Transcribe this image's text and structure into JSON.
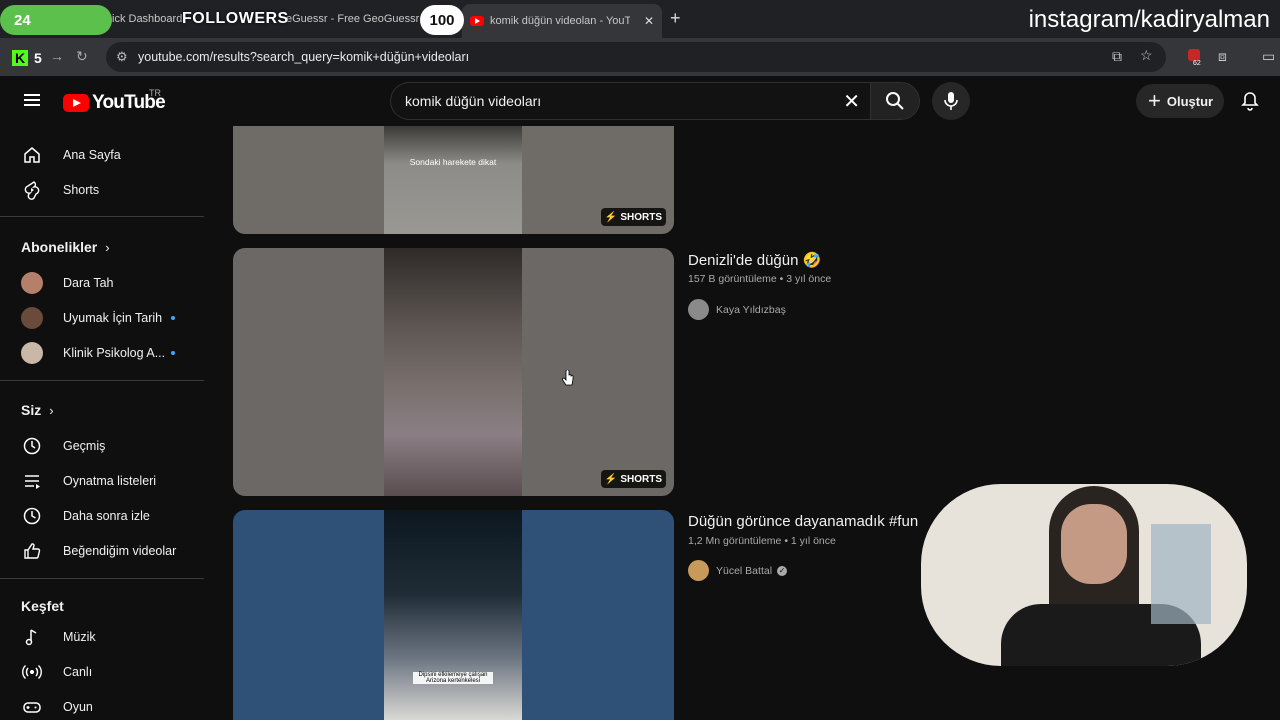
{
  "overlay": {
    "left_badge_number": "24",
    "followers_label": "FOLLOWERS",
    "followers_count": "100",
    "instagram_handle": "instagram/kadiryalman",
    "kick_count": "5"
  },
  "browser": {
    "tabs": [
      {
        "label": "ick Dashboard"
      },
      {
        "label": "eGuessr - Free GeoGuessr A"
      },
      {
        "label": "komik düğün videolan - YouTu",
        "active": true
      }
    ],
    "url": "youtube.com/results?search_query=komik+düğün+videoları",
    "extension_badge": "62"
  },
  "header": {
    "logo_text": "YouTube",
    "country_code": "TR",
    "search_value": "komik düğün videoları",
    "create_label": "Oluştur"
  },
  "sidebar": {
    "main": [
      {
        "label": "Ana Sayfa",
        "icon": "home-icon"
      },
      {
        "label": "Shorts",
        "icon": "shorts-icon"
      }
    ],
    "subscriptions_heading": "Abonelikler",
    "subscriptions": [
      {
        "label": "Dara Tah",
        "new": false
      },
      {
        "label": "Uyumak İçin Tarih",
        "new": true
      },
      {
        "label": "Klinik Psikolog A...",
        "new": true
      }
    ],
    "you_heading": "Siz",
    "you": [
      {
        "label": "Geçmiş",
        "icon": "history-icon"
      },
      {
        "label": "Oynatma listeleri",
        "icon": "playlists-icon"
      },
      {
        "label": "Daha sonra izle",
        "icon": "watch-later-icon"
      },
      {
        "label": "Beğendiğim videolar",
        "icon": "like-icon"
      }
    ],
    "explore_heading": "Keşfet",
    "explore": [
      {
        "label": "Müzik",
        "icon": "music-icon"
      },
      {
        "label": "Canlı",
        "icon": "live-icon"
      },
      {
        "label": "Oyun",
        "icon": "gaming-icon"
      }
    ]
  },
  "results": [
    {
      "badge": "SHORTS",
      "overlay_caption": "Sondaki harekete dikat"
    },
    {
      "title": "Denizli'de düğün 🤣",
      "views": "157 B görüntüleme",
      "age": "3 yıl önce",
      "channel": "Kaya Yıldızbaş",
      "badge": "SHORTS"
    },
    {
      "title": "Düğün görünce dayanamadık #fun",
      "views": "1,2 Mn görüntüleme",
      "age": "1 yıl önce",
      "channel": "Yücel Battal",
      "verified": true,
      "overlay_caption": "Dipsini etkilemeye çalışan Arizona kertenkelesi"
    }
  ]
}
